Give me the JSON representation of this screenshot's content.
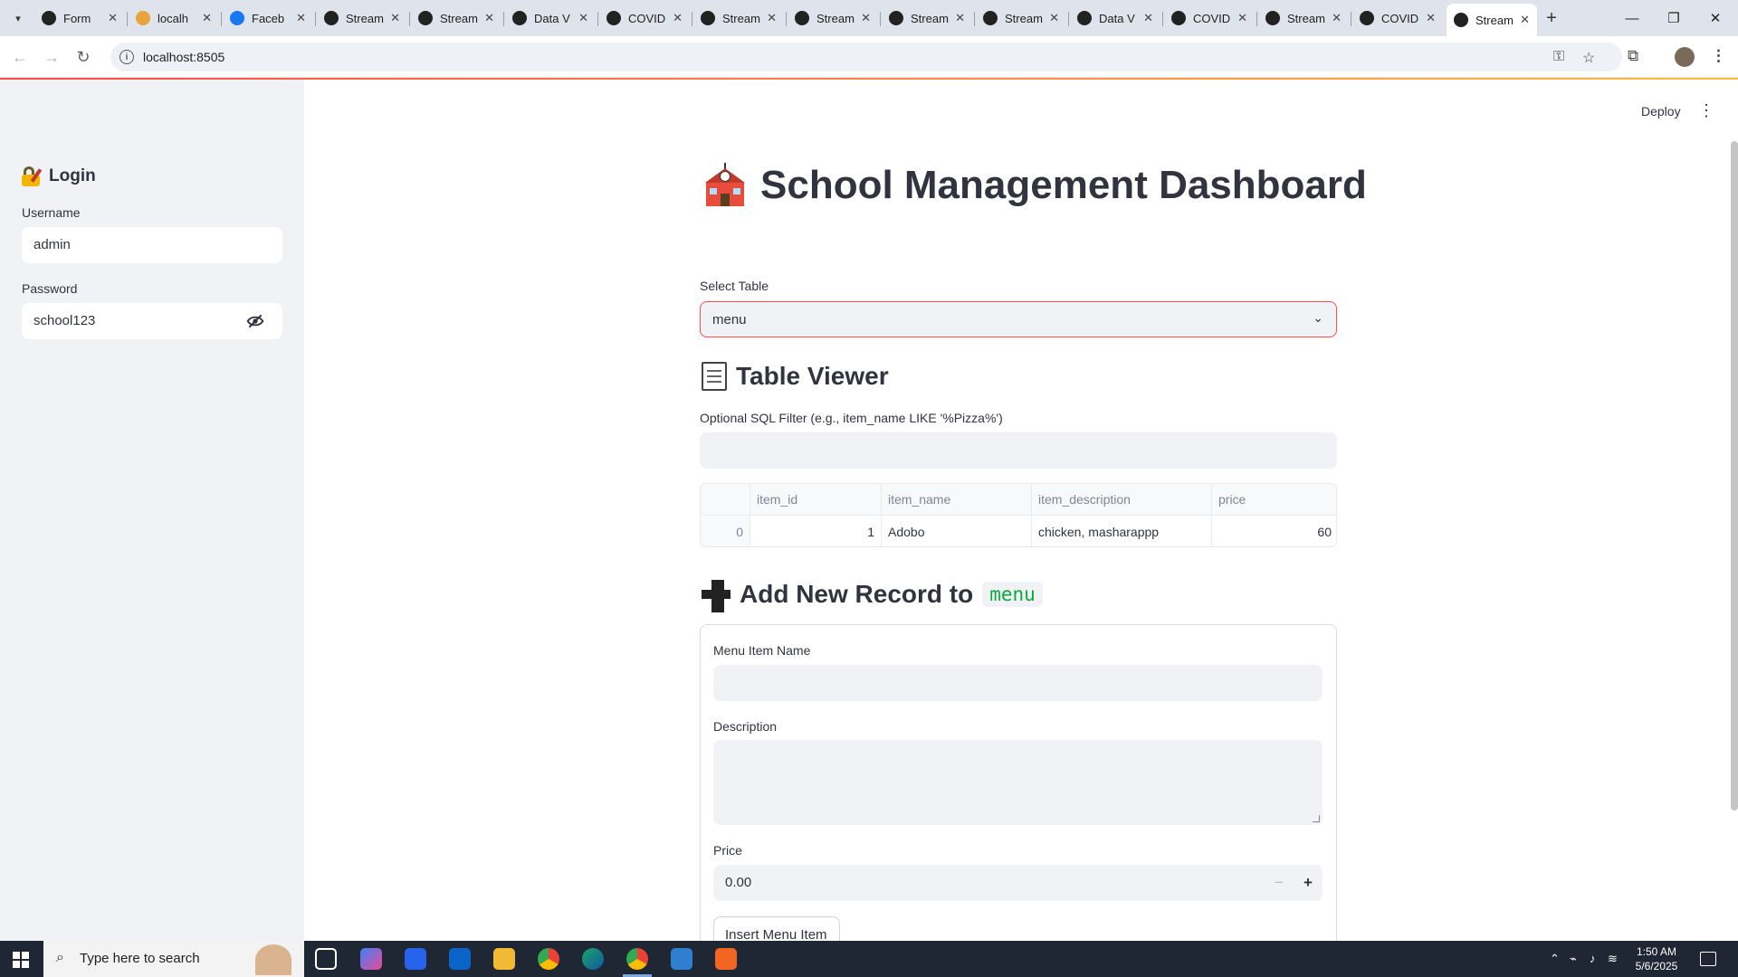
{
  "browser": {
    "tabs": [
      {
        "title": "Form",
        "favicon_color": "#222222"
      },
      {
        "title": "localh",
        "favicon_color": "#e8a33d"
      },
      {
        "title": "Faceb",
        "favicon_color": "#1877f2"
      },
      {
        "title": "Stream",
        "favicon_color": "#222222"
      },
      {
        "title": "Stream",
        "favicon_color": "#222222"
      },
      {
        "title": "Data V",
        "favicon_color": "#222222"
      },
      {
        "title": "COVID",
        "favicon_color": "#222222"
      },
      {
        "title": "Stream",
        "favicon_color": "#222222"
      },
      {
        "title": "Stream",
        "favicon_color": "#222222"
      },
      {
        "title": "Stream",
        "favicon_color": "#222222"
      },
      {
        "title": "Stream",
        "favicon_color": "#222222"
      },
      {
        "title": "Data V",
        "favicon_color": "#222222"
      },
      {
        "title": "COVID",
        "favicon_color": "#222222"
      },
      {
        "title": "Stream",
        "favicon_color": "#222222"
      },
      {
        "title": "COVID",
        "favicon_color": "#222222"
      },
      {
        "title": "Stream",
        "favicon_color": "#222222",
        "active": true
      }
    ],
    "url": "localhost:8505"
  },
  "app": {
    "deploy_label": "Deploy",
    "accent_color": "#ff4b4b"
  },
  "sidebar": {
    "title": "Login",
    "username_label": "Username",
    "username_value": "admin",
    "password_label": "Password",
    "password_value": "school123"
  },
  "main": {
    "title": "School Management Dashboard",
    "select_table_label": "Select Table",
    "select_table_value": "menu",
    "table_viewer_title": "Table Viewer",
    "filter_label": "Optional SQL Filter (e.g., item_name LIKE '%Pizza%')",
    "filter_value": "",
    "table": {
      "columns": [
        "",
        "item_id",
        "item_name",
        "item_description",
        "price"
      ],
      "rows": [
        [
          "0",
          "1",
          "Adobo",
          "chicken, masharappp",
          "60"
        ]
      ]
    },
    "add_record_title": "Add New Record to",
    "add_record_table": "menu",
    "form": {
      "name_label": "Menu Item Name",
      "name_value": "",
      "description_label": "Description",
      "price_label": "Price",
      "price_value": "0.00",
      "submit_label": "Insert Menu Item"
    }
  },
  "taskbar": {
    "search_placeholder": "Type here to search",
    "time": "1:50 AM",
    "date": "5/6/2025"
  }
}
